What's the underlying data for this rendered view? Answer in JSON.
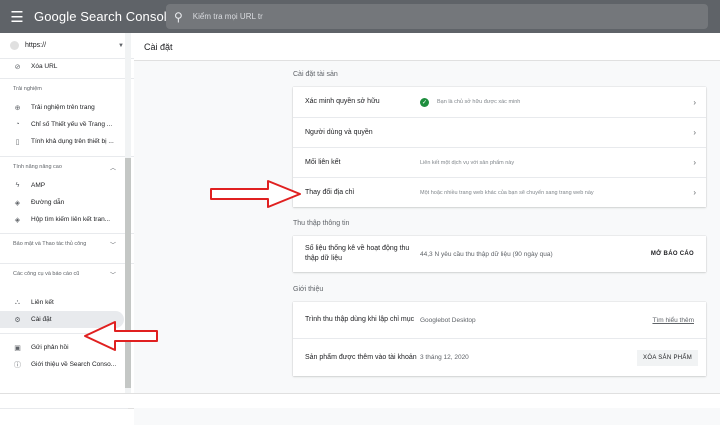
{
  "topbar": {
    "app_title": "Google Search Console",
    "search_placeholder": "Kiểm tra mọi URL tr"
  },
  "sidebar": {
    "property": "https://",
    "top_item": "Xóa URL",
    "sections": [
      {
        "heading": "Trải nghiệm",
        "items": [
          "Trải nghiệm trên trang",
          "Chỉ số Thiết yếu về Trang ...",
          "Tính khả dụng trên thiết bị ..."
        ]
      },
      {
        "heading": "Tính năng nâng cao",
        "items": [
          "AMP",
          "Đường dẫn",
          "Hộp tìm kiếm liên kết tran..."
        ]
      },
      {
        "heading": "Bảo mật và Thao tác thủ công",
        "items": []
      },
      {
        "heading": "Các công cụ và báo cáo cũ",
        "items": []
      }
    ],
    "bottom_items": [
      "Liên kết",
      "Cài đặt",
      "Gửi phản hồi",
      "Giới thiệu về Search Conso..."
    ]
  },
  "main": {
    "page_title": "Cài đặt",
    "property_settings": {
      "label": "Cài đặt tài sản",
      "rows": [
        {
          "title": "Xác minh quyền sở hữu",
          "value": "Bạn là chủ sở hữu được xác minh"
        },
        {
          "title": "Người dùng và quyền",
          "value": ""
        },
        {
          "title": "Mối liên kết",
          "value": "Liên kết một dịch vụ với sản phẩm này"
        },
        {
          "title": "Thay đổi địa chỉ",
          "value": "Một hoặc nhiều trang web khác của bạn sẽ chuyển sang trang web này"
        }
      ]
    },
    "crawl": {
      "label": "Thu thập thông tin",
      "title": "Số liệu thống kê về hoạt động thu thập dữ liệu",
      "value": "44,3 N yêu cầu thu thập dữ liệu (90 ngày qua)",
      "button": "MỞ BÁO CÁO"
    },
    "about": {
      "label": "Giới thiệu",
      "rows": [
        {
          "title": "Trình thu thập dùng khi lập chỉ mục",
          "value": "Googlebot Desktop",
          "action": "Tìm hiểu thêm"
        },
        {
          "title": "Sản phẩm được thêm vào tài khoản",
          "value": "3 tháng 12, 2020",
          "action": "XÓA SẢN PHẨM"
        }
      ]
    }
  },
  "colors": {
    "topbar": "#5f6368",
    "verified": "#1e8e3e",
    "annotation_arrow": "#e02020"
  },
  "icons": [
    "menu-icon",
    "search-icon",
    "remove-url-icon",
    "page-experience-icon",
    "speed-icon",
    "mobile-icon",
    "amp-icon",
    "breadcrumb-icon",
    "sitelinks-icon",
    "links-icon",
    "settings-icon",
    "feedback-icon",
    "info-icon",
    "check-circle-icon",
    "chevron-right-icon"
  ]
}
